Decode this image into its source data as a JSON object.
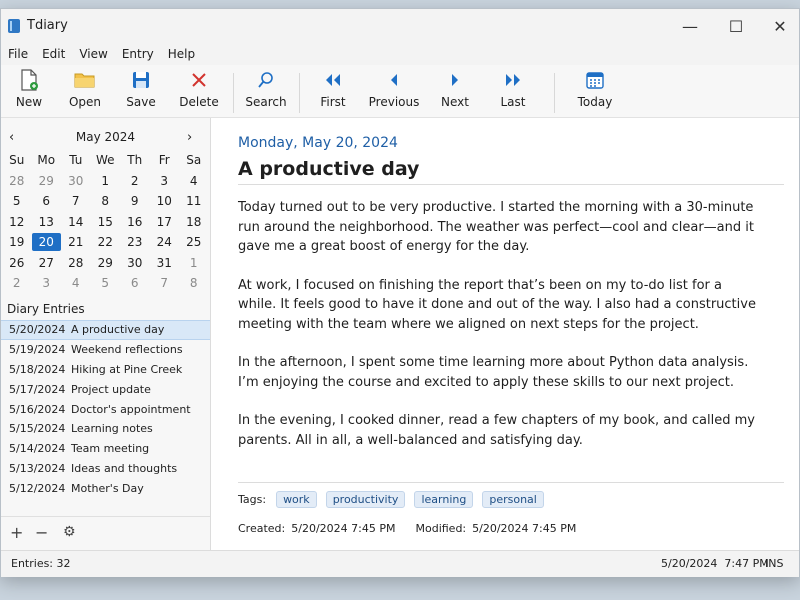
{
  "app": {
    "title": "Tdiary"
  },
  "window": {
    "minimize": "—",
    "maximize": "☐",
    "close": "✕"
  },
  "menu": [
    "File",
    "Edit",
    "View",
    "Entry",
    "Help"
  ],
  "toolbar": {
    "new": "New",
    "open": "Open",
    "save": "Save",
    "delete": "Delete",
    "search": "Search",
    "first": "First",
    "previous": "Previous",
    "next": "Next",
    "last": "Last",
    "today": "Today"
  },
  "calendar": {
    "month": "May 2024",
    "prev": "‹",
    "next": "›",
    "dow": [
      "Su",
      "Mo",
      "Tu",
      "We",
      "Th",
      "Fr",
      "Sa"
    ],
    "weeks": [
      [
        "28",
        "29",
        "30",
        "1",
        "2",
        "3",
        "4"
      ],
      [
        "5",
        "6",
        "7",
        "8",
        "9",
        "10",
        "11"
      ],
      [
        "12",
        "13",
        "14",
        "15",
        "16",
        "17",
        "18"
      ],
      [
        "19",
        "20",
        "21",
        "22",
        "23",
        "24",
        "25"
      ],
      [
        "26",
        "27",
        "28",
        "29",
        "30",
        "31",
        "1"
      ],
      [
        "2",
        "3",
        "4",
        "5",
        "6",
        "7",
        "8"
      ]
    ],
    "selected_day": "20"
  },
  "entries_title": "Diary Entries",
  "entries": [
    {
      "date": "5/20/2024",
      "title": "A productive day",
      "selected": true
    },
    {
      "date": "5/19/2024",
      "title": "Weekend reflections"
    },
    {
      "date": "5/18/2024",
      "title": "Hiking at Pine Creek"
    },
    {
      "date": "5/17/2024",
      "title": "Project update"
    },
    {
      "date": "5/16/2024",
      "title": "Doctor's appointment"
    },
    {
      "date": "5/15/2024",
      "title": "Learning notes"
    },
    {
      "date": "5/14/2024",
      "title": "Team meeting"
    },
    {
      "date": "5/13/2024",
      "title": "Ideas and thoughts"
    },
    {
      "date": "5/12/2024",
      "title": "Mother's Day"
    }
  ],
  "left_footer": {
    "add": "+",
    "remove": "−",
    "settings": "⚙"
  },
  "entry": {
    "date_heading": "Monday, May 20, 2024",
    "title": "A productive day",
    "paragraphs": [
      "Today turned out to be very productive. I started the morning with a 30-minute run around the neighborhood. The weather was perfect—cool and clear—and it gave me a great boost of energy for the day.",
      "At work, I focused on finishing the report that’s been on my to-do list for a while. It feels good to have it done and out of the way. I also had a constructive meeting with the team where we aligned on next steps for the project.",
      "In the afternoon, I spent some time learning more about Python data analysis. I’m enjoying the course and excited to apply these skills to our next project.",
      "In the evening, I cooked dinner, read a few chapters of my book, and called my parents. All in all, a well-balanced and satisfying day."
    ],
    "tags_label": "Tags:",
    "tags": [
      "work",
      "productivity",
      "learning",
      "personal"
    ],
    "created_label": "Created:",
    "created": "5/20/2024 7:45 PM",
    "modified_label": "Modified:",
    "modified": "5/20/2024 7:45 PM"
  },
  "status": {
    "entries_label": "Entries:",
    "entries_count": "32",
    "datetime": "5/20/2024  7:47 PM",
    "mode": "INS"
  },
  "colors": {
    "accent": "#1f6fc5",
    "heading": "#1f5fa6",
    "selected_row": "#d9e8f7"
  }
}
